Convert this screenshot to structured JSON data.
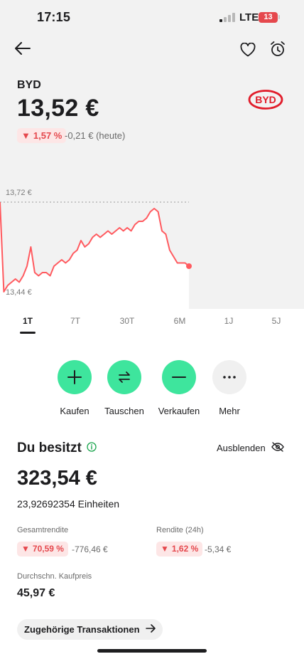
{
  "status_bar": {
    "time": "17:15",
    "network": "LTE",
    "battery": "13"
  },
  "stock": {
    "name": "BYD",
    "price": "13,52 €",
    "change_pct": "1,57 %",
    "change_abs": "-0,21 € (heute)",
    "logo_text": "BYD",
    "logo_color": "#e11d2b"
  },
  "chart_data": {
    "type": "area",
    "title": "",
    "high_label": "13,72 €",
    "low_label": "13,44 €",
    "ylim": [
      13.44,
      13.72
    ],
    "reference_line": 13.72,
    "line_color": "#ff5a5f",
    "fill_color": "#ffffff",
    "y": [
      13.72,
      13.44,
      13.46,
      13.47,
      13.48,
      13.47,
      13.49,
      13.52,
      13.58,
      13.5,
      13.49,
      13.5,
      13.5,
      13.49,
      13.52,
      13.53,
      13.54,
      13.53,
      13.54,
      13.56,
      13.57,
      13.6,
      13.58,
      13.59,
      13.61,
      13.62,
      13.61,
      13.62,
      13.63,
      13.62,
      13.63,
      13.64,
      13.63,
      13.64,
      13.63,
      13.65,
      13.66,
      13.66,
      13.67,
      13.69,
      13.7,
      13.69,
      13.63,
      13.62,
      13.57,
      13.55,
      13.53,
      13.53,
      13.53,
      13.52
    ]
  },
  "periods": [
    "1T",
    "7T",
    "30T",
    "6M",
    "1J",
    "5J"
  ],
  "active_period": "1T",
  "actions": [
    {
      "label": "Kaufen",
      "icon": "plus-icon"
    },
    {
      "label": "Tauschen",
      "icon": "swap-icon"
    },
    {
      "label": "Verkaufen",
      "icon": "minus-icon"
    },
    {
      "label": "Mehr",
      "icon": "more-icon"
    }
  ],
  "holdings": {
    "title": "Du besitzt",
    "hide_label": "Ausblenden",
    "value": "323,54 €",
    "units": "23,92692354 Einheiten",
    "total_return_label": "Gesamtrendite",
    "total_return_pct": "70,59 %",
    "total_return_abs": "-776,46 €",
    "return24_label": "Rendite (24h)",
    "return24_pct": "1,62 %",
    "return24_abs": "-5,34 €",
    "avg_price_label": "Durchschn. Kaufpreis",
    "avg_price": "45,97 €",
    "transactions_label": "Zugehörige Transaktionen"
  },
  "colors": {
    "accent": "#3ee59d",
    "negative": "#e5484d",
    "background_top": "#f2f2f2"
  }
}
